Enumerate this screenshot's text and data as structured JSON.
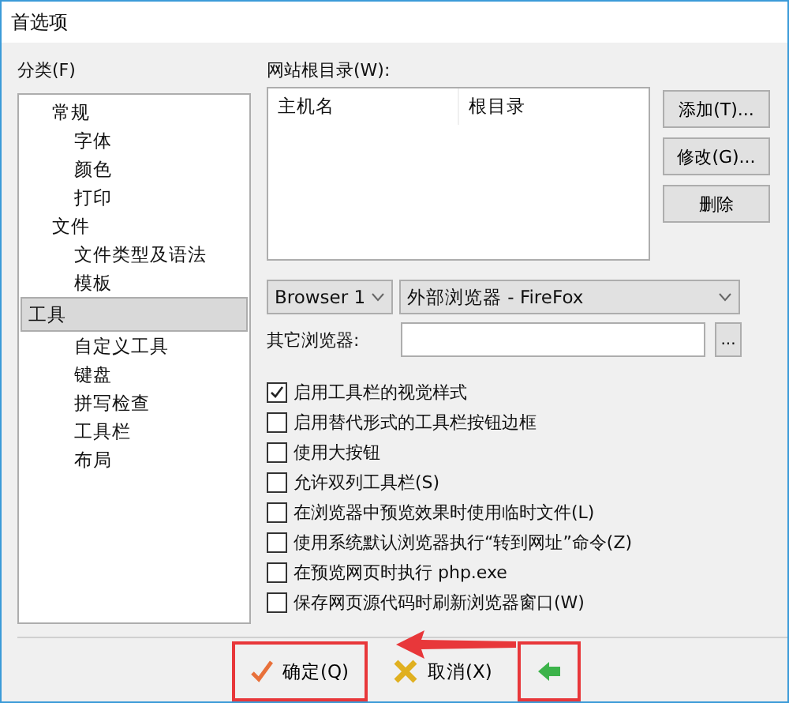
{
  "window": {
    "title": "首选项"
  },
  "category": {
    "label": "分类(F)",
    "items": [
      {
        "label": "常规",
        "selected": false,
        "children": [
          {
            "label": "字体",
            "selected": false
          },
          {
            "label": "颜色",
            "selected": false
          },
          {
            "label": "打印",
            "selected": false
          }
        ]
      },
      {
        "label": "文件",
        "selected": false,
        "children": [
          {
            "label": "文件类型及语法",
            "selected": false
          },
          {
            "label": "模板",
            "selected": false
          }
        ]
      },
      {
        "label": "工具",
        "selected": true,
        "children": [
          {
            "label": "自定义工具",
            "selected": false
          },
          {
            "label": "键盘",
            "selected": false
          },
          {
            "label": "拼写检查",
            "selected": false
          },
          {
            "label": "工具栏",
            "selected": false
          },
          {
            "label": "布局",
            "selected": false
          }
        ]
      }
    ]
  },
  "site_roots": {
    "label": "网站根目录(W):",
    "columns": [
      "主机名",
      "根目录"
    ],
    "buttons": [
      "添加(T)...",
      "修改(G)...",
      "删除"
    ]
  },
  "browser_select": {
    "value": "Browser 1"
  },
  "browser_type_select": {
    "value": "外部浏览器 - FireFox"
  },
  "other_browser": {
    "label": "其它浏览器:",
    "browse_button": "..."
  },
  "options": [
    {
      "label": "启用工具栏的视觉样式",
      "checked": true
    },
    {
      "label": "启用替代形式的工具栏按钮边框",
      "checked": false
    },
    {
      "label": "使用大按钮",
      "checked": false
    },
    {
      "label": "允许双列工具栏(S)",
      "checked": false
    },
    {
      "label": "在浏览器中预览效果时使用临时文件(L)",
      "checked": false
    },
    {
      "label": "使用系统默认浏览器执行“转到网址”命令(Z)",
      "checked": false
    },
    {
      "label": "在预览网页时执行 php.exe",
      "checked": false
    },
    {
      "label": "保存网页源代码时刷新浏览器窗口(W)",
      "checked": false
    }
  ],
  "footer": {
    "buttons": [
      {
        "kind": "ok",
        "label": "确定(Q)",
        "highlighted": true
      },
      {
        "kind": "cancel",
        "label": "取消(X)",
        "highlighted": false
      },
      {
        "kind": "back",
        "highlighted": true
      }
    ]
  }
}
